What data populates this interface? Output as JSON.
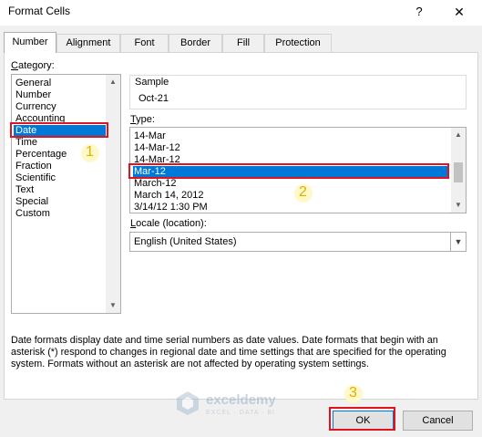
{
  "window": {
    "title": "Format Cells",
    "help_glyph": "?",
    "close_glyph": "✕"
  },
  "tabs": [
    {
      "label": "Number",
      "active": true
    },
    {
      "label": "Alignment"
    },
    {
      "label": "Font"
    },
    {
      "label": "Border"
    },
    {
      "label": "Fill"
    },
    {
      "label": "Protection"
    }
  ],
  "category": {
    "label_prefix": "",
    "label_underline": "C",
    "label_rest": "ategory:",
    "items": [
      "General",
      "Number",
      "Currency",
      "Accounting",
      "Date",
      "Time",
      "Percentage",
      "Fraction",
      "Scientific",
      "Text",
      "Special",
      "Custom"
    ],
    "selected": "Date"
  },
  "sample": {
    "label": "Sample",
    "value": "Oct-21"
  },
  "type": {
    "label_underline": "T",
    "label_rest": "ype:",
    "items": [
      "14-Mar",
      "14-Mar-12",
      "14-Mar-12",
      "Mar-12",
      "March-12",
      "March 14, 2012",
      "3/14/12 1:30 PM"
    ],
    "selected": "Mar-12"
  },
  "locale": {
    "label_underline": "L",
    "label_rest": "ocale (location):",
    "value": "English (United States)"
  },
  "description": "Date formats display date and time serial numbers as date values.  Date formats that begin with an asterisk (*) respond to changes in regional date and time settings that are specified for the operating system. Formats without an asterisk are not affected by operating system settings.",
  "buttons": {
    "ok": "OK",
    "cancel": "Cancel"
  },
  "steps": [
    "1",
    "2",
    "3"
  ],
  "watermark": {
    "name": "exceldemy",
    "tagline": "EXCEL · DATA · BI"
  },
  "colors": {
    "selection": "#0078d7",
    "highlight_box": "#e0141e",
    "step_number": "#e0b000"
  },
  "icons": {
    "scroll_up": "▲",
    "scroll_down": "▼",
    "dropdown": "▼"
  }
}
